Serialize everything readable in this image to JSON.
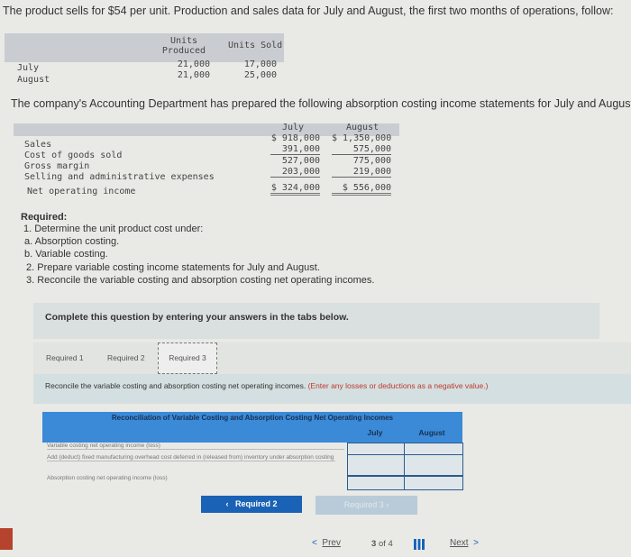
{
  "intro": "The product sells for $54 per unit. Production and sales data for July and August, the first two months of operations, follow:",
  "units_table": {
    "headers": [
      "Units Produced",
      "Units Sold"
    ],
    "rows": [
      {
        "label": "July",
        "produced": "21,000",
        "sold": "17,000"
      },
      {
        "label": "August",
        "produced": "21,000",
        "sold": "25,000"
      }
    ]
  },
  "sentence2": "The company's Accounting Department has prepared the following absorption costing income statements for July and August:",
  "income": {
    "headers": [
      "July",
      "August"
    ],
    "rows": [
      {
        "label": "Sales",
        "july": "$ 918,000",
        "august": "$ 1,350,000"
      },
      {
        "label": "Cost of goods sold",
        "july": "391,000",
        "august": "575,000"
      },
      {
        "label": "Gross margin",
        "july": "527,000",
        "august": "775,000"
      },
      {
        "label": "Selling and administrative expenses",
        "july": "203,000",
        "august": "219,000"
      },
      {
        "label": "Net operating income",
        "july": "$ 324,000",
        "august": "$ 556,000"
      }
    ]
  },
  "required": {
    "title": "Required:",
    "lines": [
      "1. Determine the unit product cost under:",
      "a. Absorption costing.",
      "b. Variable costing.",
      "2. Prepare variable costing income statements for July and August.",
      "3. Reconcile the variable costing and absorption costing net operating incomes."
    ]
  },
  "complete": "Complete this question by entering your answers in the tabs below.",
  "tabs": [
    "Required 1",
    "Required 2",
    "Required 3"
  ],
  "active_tab": 2,
  "instruction": "Reconcile the variable costing and absorption costing net operating incomes.",
  "instruction_note": "(Enter any losses or deductions as a negative value.)",
  "recon": {
    "title": "Reconciliation of Variable Costing and Absorption Costing Net Operating Incomes",
    "cols": [
      "July",
      "August"
    ],
    "rows": [
      "Variable costing net operating income (loss)",
      "Add (deduct) fixed manufacturing overhead cost deferred in (released from) inventory under absorption costing",
      "Absorption costing net operating income (loss)"
    ],
    "values": [
      [
        "",
        ""
      ],
      [
        "",
        ""
      ],
      [
        "",
        ""
      ]
    ]
  },
  "buttons": {
    "prev_req": "Required 2",
    "next_req": "Required 3"
  },
  "nav": {
    "prev": "Prev",
    "page": "3",
    "of": "of",
    "total": "4",
    "next": "Next"
  },
  "colors": {
    "blue": "#3a8ad8",
    "button": "#1a62b5"
  }
}
